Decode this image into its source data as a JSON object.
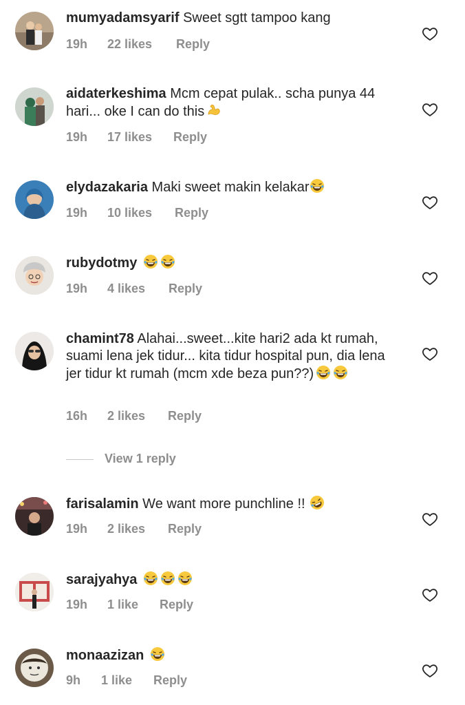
{
  "comments": [
    {
      "username": "mumyadamsyarif",
      "text": "Sweet sgtt tampoo kang",
      "time": "19h",
      "likes": "22 likes",
      "reply": "Reply",
      "emojis": []
    },
    {
      "username": "aidaterkeshima",
      "text": "Mcm cepat pulak.. scha punya 44 hari... oke I can do this",
      "time": "19h",
      "likes": "17 likes",
      "reply": "Reply",
      "emojis": [
        "flexed-biceps"
      ]
    },
    {
      "username": "elydazakaria",
      "text": "Maki sweet makin kelakar",
      "time": "19h",
      "likes": "10 likes",
      "reply": "Reply",
      "emojis": [
        "tears-of-joy"
      ]
    },
    {
      "username": "rubydotmy",
      "text": "",
      "time": "19h",
      "likes": "4 likes",
      "reply": "Reply",
      "emojis": [
        "tears-of-joy",
        "tears-of-joy"
      ]
    },
    {
      "username": "chamint78",
      "text": "Alahai...sweet...kite hari2 ada kt rumah, suami lena jek tidur... kita tidur hospital pun, dia lena jer tidur kt rumah (mcm xde beza pun??)",
      "time": "16h",
      "likes": "2 likes",
      "reply": "Reply",
      "emojis": [
        "tears-of-joy",
        "tears-of-joy"
      ]
    },
    {
      "username": "farisalamin",
      "text": "We want more punchline !!",
      "time": "19h",
      "likes": "2 likes",
      "reply": "Reply",
      "emojis": [
        "rolling-laughing"
      ]
    },
    {
      "username": "sarajyahya",
      "text": "",
      "time": "19h",
      "likes": "1 like",
      "reply": "Reply",
      "emojis": [
        "tears-of-joy",
        "tears-of-joy",
        "tears-of-joy"
      ]
    },
    {
      "username": "monaazizan",
      "text": "",
      "time": "9h",
      "likes": "1 like",
      "reply": "Reply",
      "emojis": [
        "tears-of-joy"
      ]
    }
  ],
  "view_replies": "View 1 reply",
  "colors": {
    "text": "#262626",
    "meta": "#8e8e8e",
    "divider": "#c7c7c7"
  },
  "icons": {
    "like": "heart-outline-icon"
  }
}
